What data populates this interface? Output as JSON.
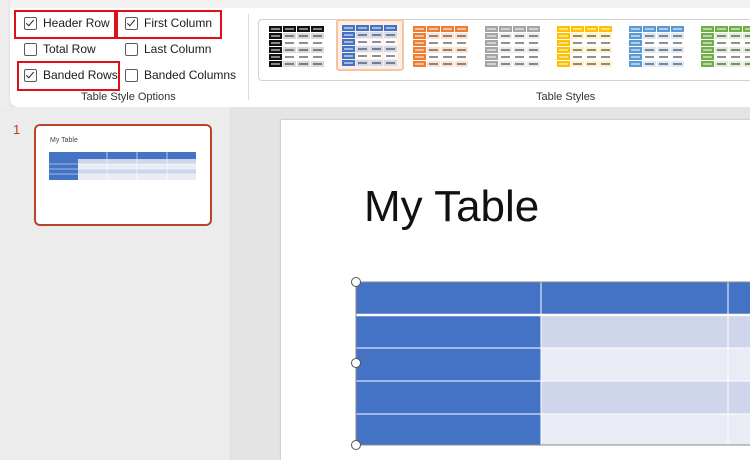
{
  "table_style_options": {
    "group_label": "Table Style Options",
    "options": [
      {
        "label": "Header Row",
        "checked": true,
        "highlighted": true
      },
      {
        "label": "First Column",
        "checked": true,
        "highlighted": true
      },
      {
        "label": "Total Row",
        "checked": false,
        "highlighted": false
      },
      {
        "label": "Last Column",
        "checked": false,
        "highlighted": false
      },
      {
        "label": "Banded Rows",
        "checked": true,
        "highlighted": true
      },
      {
        "label": "Banded Columns",
        "checked": false,
        "highlighted": false
      }
    ]
  },
  "table_styles": {
    "group_label": "Table Styles",
    "swatches": [
      {
        "name": "black-style",
        "accent": "#111111",
        "band": "#d9d9d9",
        "selected": false
      },
      {
        "name": "blue-style",
        "accent": "#4472c4",
        "band": "#d2d9ee",
        "selected": true
      },
      {
        "name": "orange-style",
        "accent": "#ed7d31",
        "band": "#fbe1d0",
        "selected": false
      },
      {
        "name": "gray-style",
        "accent": "#a5a5a5",
        "band": "#ececec",
        "selected": false
      },
      {
        "name": "gold-style",
        "accent": "#ffc000",
        "band": "#fff1c8",
        "selected": false
      },
      {
        "name": "lightblue-style",
        "accent": "#5b9bd5",
        "band": "#dbe8f5",
        "selected": false
      },
      {
        "name": "green-style",
        "accent": "#70ad47",
        "band": "#dfeed4",
        "selected": false
      }
    ]
  },
  "slides_pane": {
    "slide_number": "1",
    "thumbnail_title": "My Table"
  },
  "slide": {
    "title": "My Table"
  },
  "colors": {
    "table_header": "#4472c4",
    "table_band_dark": "#cfd5ea",
    "table_band_light": "#e9ebf5"
  }
}
